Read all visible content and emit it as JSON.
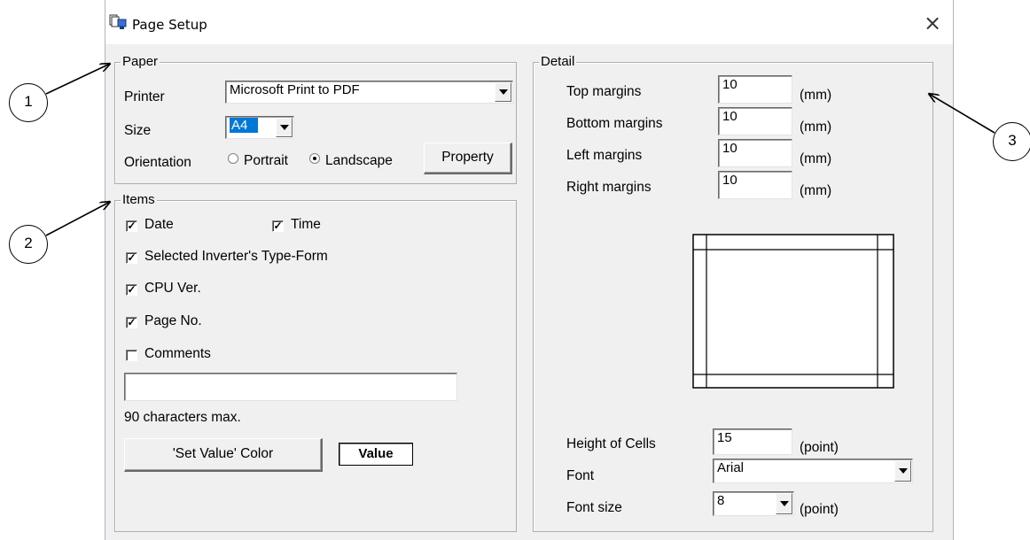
{
  "window": {
    "title": "Page Setup",
    "close_glyph": "×",
    "icon": "page-setup-icon"
  },
  "callouts": [
    "1",
    "2",
    "3"
  ],
  "paper": {
    "legend": "Paper",
    "printer_label": "Printer",
    "printer_value": "Microsoft Print to PDF",
    "size_label": "Size",
    "size_value": "A4",
    "orientation_label": "Orientation",
    "portrait_label": "Portrait",
    "landscape_label": "Landscape",
    "selected_orientation": "Landscape",
    "property_button": "Property"
  },
  "items": {
    "legend": "Items",
    "date_label": "Date",
    "date_checked": true,
    "time_label": "Time",
    "time_checked": true,
    "inverter_label": "Selected Inverter's Type-Form",
    "inverter_checked": true,
    "cpu_label": "CPU Ver.",
    "cpu_checked": true,
    "pageno_label": "Page No.",
    "pageno_checked": true,
    "comments_label": "Comments",
    "comments_checked": false,
    "comments_value": "",
    "max_note": "90 characters max.",
    "set_value_color_button": "'Set Value' Color",
    "value_sample": "Value"
  },
  "detail": {
    "legend": "Detail",
    "top_label": "Top margins",
    "top_value": "10",
    "top_unit": "(mm)",
    "bottom_label": "Bottom margins",
    "bottom_value": "10",
    "bottom_unit": "(mm)",
    "left_label": "Left margins",
    "left_value": "10",
    "left_unit": "(mm)",
    "right_label": "Right margins",
    "right_value": "10",
    "right_unit": "(mm)",
    "height_label": "Height of Cells",
    "height_value": "15",
    "height_unit": "(point)",
    "font_label": "Font",
    "font_value": "Arial",
    "fontsize_label": "Font size",
    "fontsize_value": "8",
    "fontsize_unit": "(point)"
  },
  "colors": {
    "dialog_bg": "#f0f0f0",
    "selection": "#0078d7"
  }
}
